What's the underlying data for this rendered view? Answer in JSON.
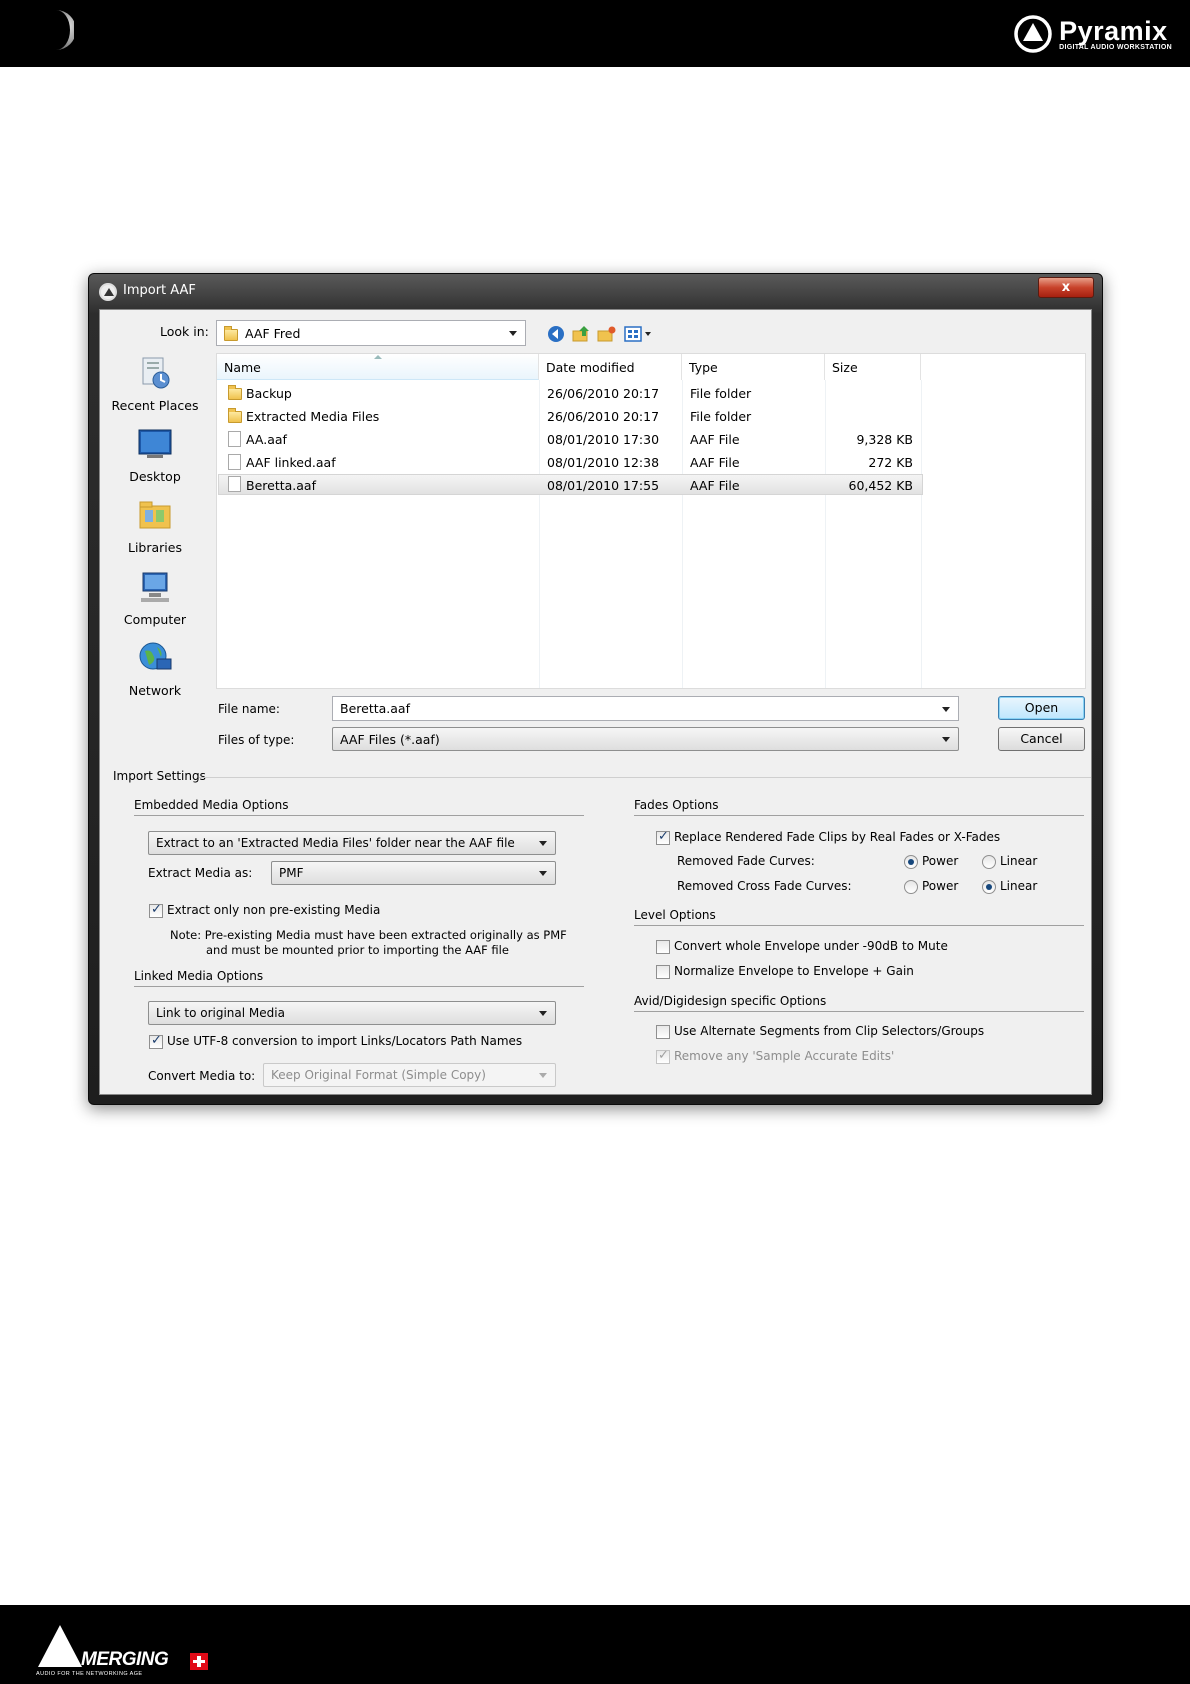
{
  "page": {
    "brand": {
      "name": "Pyramix",
      "subtitle": "DIGITAL AUDIO WORKSTATION"
    },
    "footer_brand": {
      "name": "MERGING",
      "subtitle": "AUDIO FOR THE NETWORKING AGE"
    }
  },
  "dialog": {
    "title": "Import AAF",
    "close_label": "x",
    "look_in_label": "Look in:",
    "look_in_value": "AAF Fred",
    "toolbar_icons": [
      "back-icon",
      "up-folder-icon",
      "new-folder-icon",
      "view-menu-icon"
    ],
    "places": [
      {
        "label": "Recent Places",
        "icon": "recent-places-icon"
      },
      {
        "label": "Desktop",
        "icon": "desktop-icon"
      },
      {
        "label": "Libraries",
        "icon": "libraries-icon"
      },
      {
        "label": "Computer",
        "icon": "computer-icon"
      },
      {
        "label": "Network",
        "icon": "network-icon"
      }
    ],
    "columns": [
      "Name",
      "Date modified",
      "Type",
      "Size"
    ],
    "files": [
      {
        "name": "Backup",
        "date": "26/06/2010 20:17",
        "type": "File folder",
        "size": "",
        "icon": "folder-icon"
      },
      {
        "name": "Extracted Media Files",
        "date": "26/06/2010 20:17",
        "type": "File folder",
        "size": "",
        "icon": "folder-icon"
      },
      {
        "name": "AA.aaf",
        "date": "08/01/2010 17:30",
        "type": "AAF File",
        "size": "9,328 KB",
        "icon": "file-icon"
      },
      {
        "name": "AAF linked.aaf",
        "date": "08/01/2010 12:38",
        "type": "AAF File",
        "size": "272 KB",
        "icon": "file-icon"
      },
      {
        "name": "Beretta.aaf",
        "date": "08/01/2010 17:55",
        "type": "AAF File",
        "size": "60,452 KB",
        "icon": "file-icon",
        "selected": true
      }
    ],
    "file_name_label": "File name:",
    "file_name_value": "Beretta.aaf",
    "file_type_label": "Files of type:",
    "file_type_value": "AAF Files (*.aaf)",
    "open_label": "Open",
    "cancel_label": "Cancel"
  },
  "settings": {
    "title": "Import Settings",
    "embedded": {
      "title": "Embedded Media Options",
      "extract_mode": "Extract to an 'Extracted Media Files' folder near the AAF file",
      "extract_as_label": "Extract Media as:",
      "extract_as_value": "PMF",
      "only_non_existing_label": "Extract only non pre-existing Media",
      "only_non_existing_checked": true,
      "note_line1": "Note: Pre-existing Media must have been extracted originally as PMF",
      "note_line2": "and must be mounted prior to importing the AAF file"
    },
    "linked": {
      "title": "Linked Media Options",
      "link_mode": "Link to original Media",
      "utf8_label": "Use UTF-8 conversion to import Links/Locators Path Names",
      "utf8_checked": true,
      "convert_label": "Convert Media to:",
      "convert_value": "Keep Original Format (Simple Copy)"
    },
    "fades": {
      "title": "Fades Options",
      "replace_label": "Replace Rendered Fade Clips by Real Fades or X-Fades",
      "replace_checked": true,
      "removed_fade_label": "Removed Fade Curves:",
      "removed_fade_value": "Power",
      "removed_cross_label": "Removed Cross Fade Curves:",
      "removed_cross_value": "Linear",
      "option_power": "Power",
      "option_linear": "Linear"
    },
    "level": {
      "title": "Level Options",
      "mute_label": "Convert whole Envelope under -90dB to Mute",
      "mute_checked": false,
      "normalize_label": "Normalize Envelope to Envelope + Gain",
      "normalize_checked": false
    },
    "avid": {
      "title": "Avid/Digidesign specific Options",
      "alt_segments_label": "Use Alternate Segments from Clip Selectors/Groups",
      "alt_segments_checked": false,
      "sample_accurate_label": "Remove any 'Sample Accurate Edits'",
      "sample_accurate_checked": true
    }
  }
}
